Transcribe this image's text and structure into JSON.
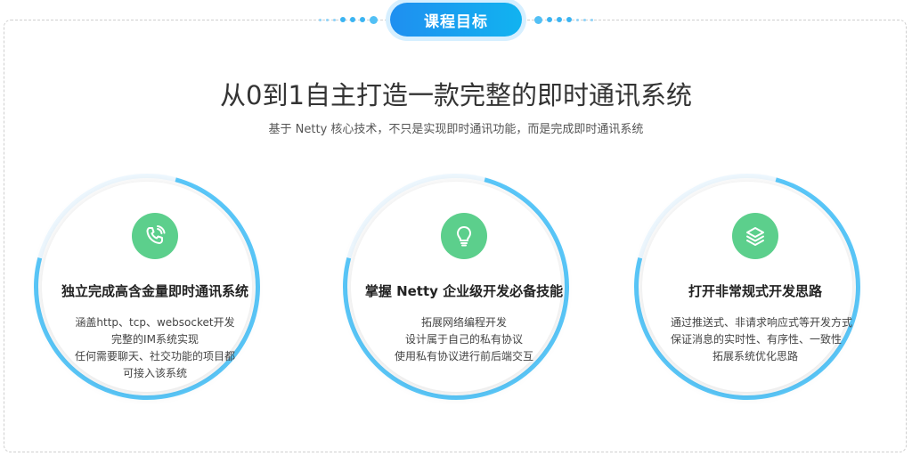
{
  "header": {
    "badge_label": "课程目标",
    "title": "从0到1自主打造一款完整的即时通讯系统",
    "subtitle": "基于 Netty 核心技术，不只是实现即时通讯功能，而是完成即时通讯系统"
  },
  "cards": [
    {
      "icon": "phone-icon",
      "title": "独立完成高含金量即时通讯系统",
      "lines": [
        "涵盖http、tcp、websocket开发",
        "完整的IM系统实现",
        "任何需要聊天、社交功能的项目都",
        "可接入该系统"
      ]
    },
    {
      "icon": "lightbulb-icon",
      "title": "掌握 Netty 企业级开发必备技能",
      "lines": [
        "拓展网络编程开发",
        "设计属于自己的私有协议",
        "使用私有协议进行前后端交互"
      ]
    },
    {
      "icon": "layers-icon",
      "title": "打开非常规式开发思路",
      "lines": [
        "通过推送式、非请求响应式等开发方式",
        "保证消息的实时性、有序性、一致性",
        "拓展系统优化思路"
      ]
    }
  ],
  "colors": {
    "accent": "#1f8ff0",
    "ring": "#5ac8fa",
    "icon_bg": "#5ccf8c"
  }
}
